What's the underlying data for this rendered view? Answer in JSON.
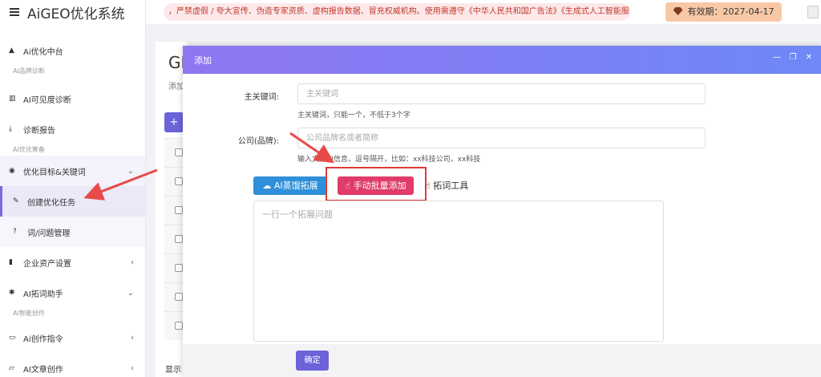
{
  "brand": {
    "title": "AiGEO优化系统"
  },
  "header": {
    "notice": "，严禁虚假 / 夸大宣传、伪造专家资质、虚构报告数据、冒充权威机构。使用需遵守《中华人民共和国广告法》《生成式人工智能服务",
    "expiry": "有效期：2027-04-17"
  },
  "sidebar": {
    "items": [
      {
        "label": "Ai优化中台",
        "icon": "home-icon"
      },
      {
        "section": "AI品牌诊断"
      },
      {
        "label": "AI可见度诊断",
        "icon": "bar-chart-icon"
      },
      {
        "label": "诊断报告",
        "icon": "download-icon"
      },
      {
        "section": "AI优化筹备"
      },
      {
        "label": "优化目标&关键词",
        "icon": "target-icon",
        "arrow": "⌄"
      },
      {
        "label": "创建优化任务",
        "icon": "edit-icon"
      },
      {
        "label": "词/问题管理",
        "icon": "question-icon"
      },
      {
        "label": "企业资产设置",
        "icon": "book-icon",
        "arrow": "‹"
      },
      {
        "label": "AI拓词助手",
        "icon": "gear-icon",
        "arrow": "⌄"
      },
      {
        "section": "AI智能创作"
      },
      {
        "label": "Ai创作指令",
        "icon": "folder-icon",
        "arrow": "‹"
      },
      {
        "label": "AI文章创作",
        "icon": "folder-open-icon",
        "arrow": "‹"
      }
    ]
  },
  "background_page": {
    "title": "GI",
    "subtitle": "添加",
    "add_label": "+",
    "footer": "显示"
  },
  "modal": {
    "title": "添加",
    "fields": {
      "keyword": {
        "label": "主关键词:",
        "placeholder": "主关键词",
        "hint": "主关键词，只能一个，不低于3个字"
      },
      "company": {
        "label": "公司(品牌):",
        "placeholder": "公司品牌名或者简称",
        "hint": "输入文案中信息，逗号隔开，比如：xx科技公司，xx科技"
      }
    },
    "buttons": {
      "ai_expand": "AI蒸馏拓展",
      "manual_add": "手动批量添加",
      "tool": "拓词工具"
    },
    "textarea_placeholder": "一行一个拓展问题",
    "confirm": "确定"
  },
  "colors": {
    "accent": "#6c63d9",
    "modal_header_start": "#8f76f2",
    "modal_header_end": "#6e88f7",
    "manual_button": "#e03b6a",
    "ai_button": "#2f8fd9",
    "annotation": "#e03a3a"
  }
}
